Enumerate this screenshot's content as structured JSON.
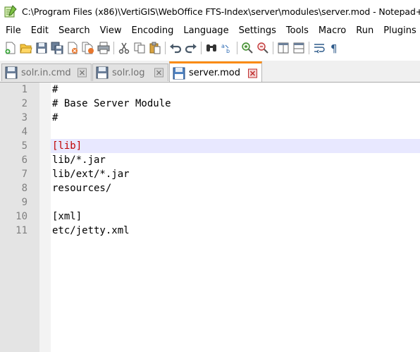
{
  "window": {
    "title": "C:\\Program Files (x86)\\VertiGIS\\WebOffice FTS-Index\\server\\modules\\server.mod - Notepad++"
  },
  "menu": [
    "File",
    "Edit",
    "Search",
    "View",
    "Encoding",
    "Language",
    "Settings",
    "Tools",
    "Macro",
    "Run",
    "Plugins"
  ],
  "toolbar": {
    "icons": [
      "new-file",
      "open-file",
      "save",
      "save-all",
      "close",
      "close-all",
      "print",
      "cut",
      "copy",
      "paste",
      "undo",
      "redo",
      "find",
      "replace",
      "zoom-in",
      "zoom-out",
      "sync-vertical",
      "sync-horizontal",
      "word-wrap",
      "show-all-characters"
    ]
  },
  "tabs": [
    {
      "label": "solr.in.cmd",
      "active": false
    },
    {
      "label": "solr.log",
      "active": false
    },
    {
      "label": "server.mod",
      "active": true
    }
  ],
  "editor": {
    "current_line": 5,
    "lines": [
      {
        "n": "1",
        "text": "#"
      },
      {
        "n": "2",
        "text": "# Base Server Module"
      },
      {
        "n": "3",
        "text": "#"
      },
      {
        "n": "4",
        "text": ""
      },
      {
        "n": "5",
        "text": "[lib]"
      },
      {
        "n": "6",
        "text": "lib/*.jar"
      },
      {
        "n": "7",
        "text": "lib/ext/*.jar"
      },
      {
        "n": "8",
        "text": "resources/"
      },
      {
        "n": "9",
        "text": ""
      },
      {
        "n": "10",
        "text": "[xml]"
      },
      {
        "n": "11",
        "text": "etc/jetty.xml"
      }
    ]
  },
  "colors": {
    "active_tab_accent": "#fa8c15",
    "bracket_match": "#c00000",
    "current_line": "#e8e8ff"
  }
}
